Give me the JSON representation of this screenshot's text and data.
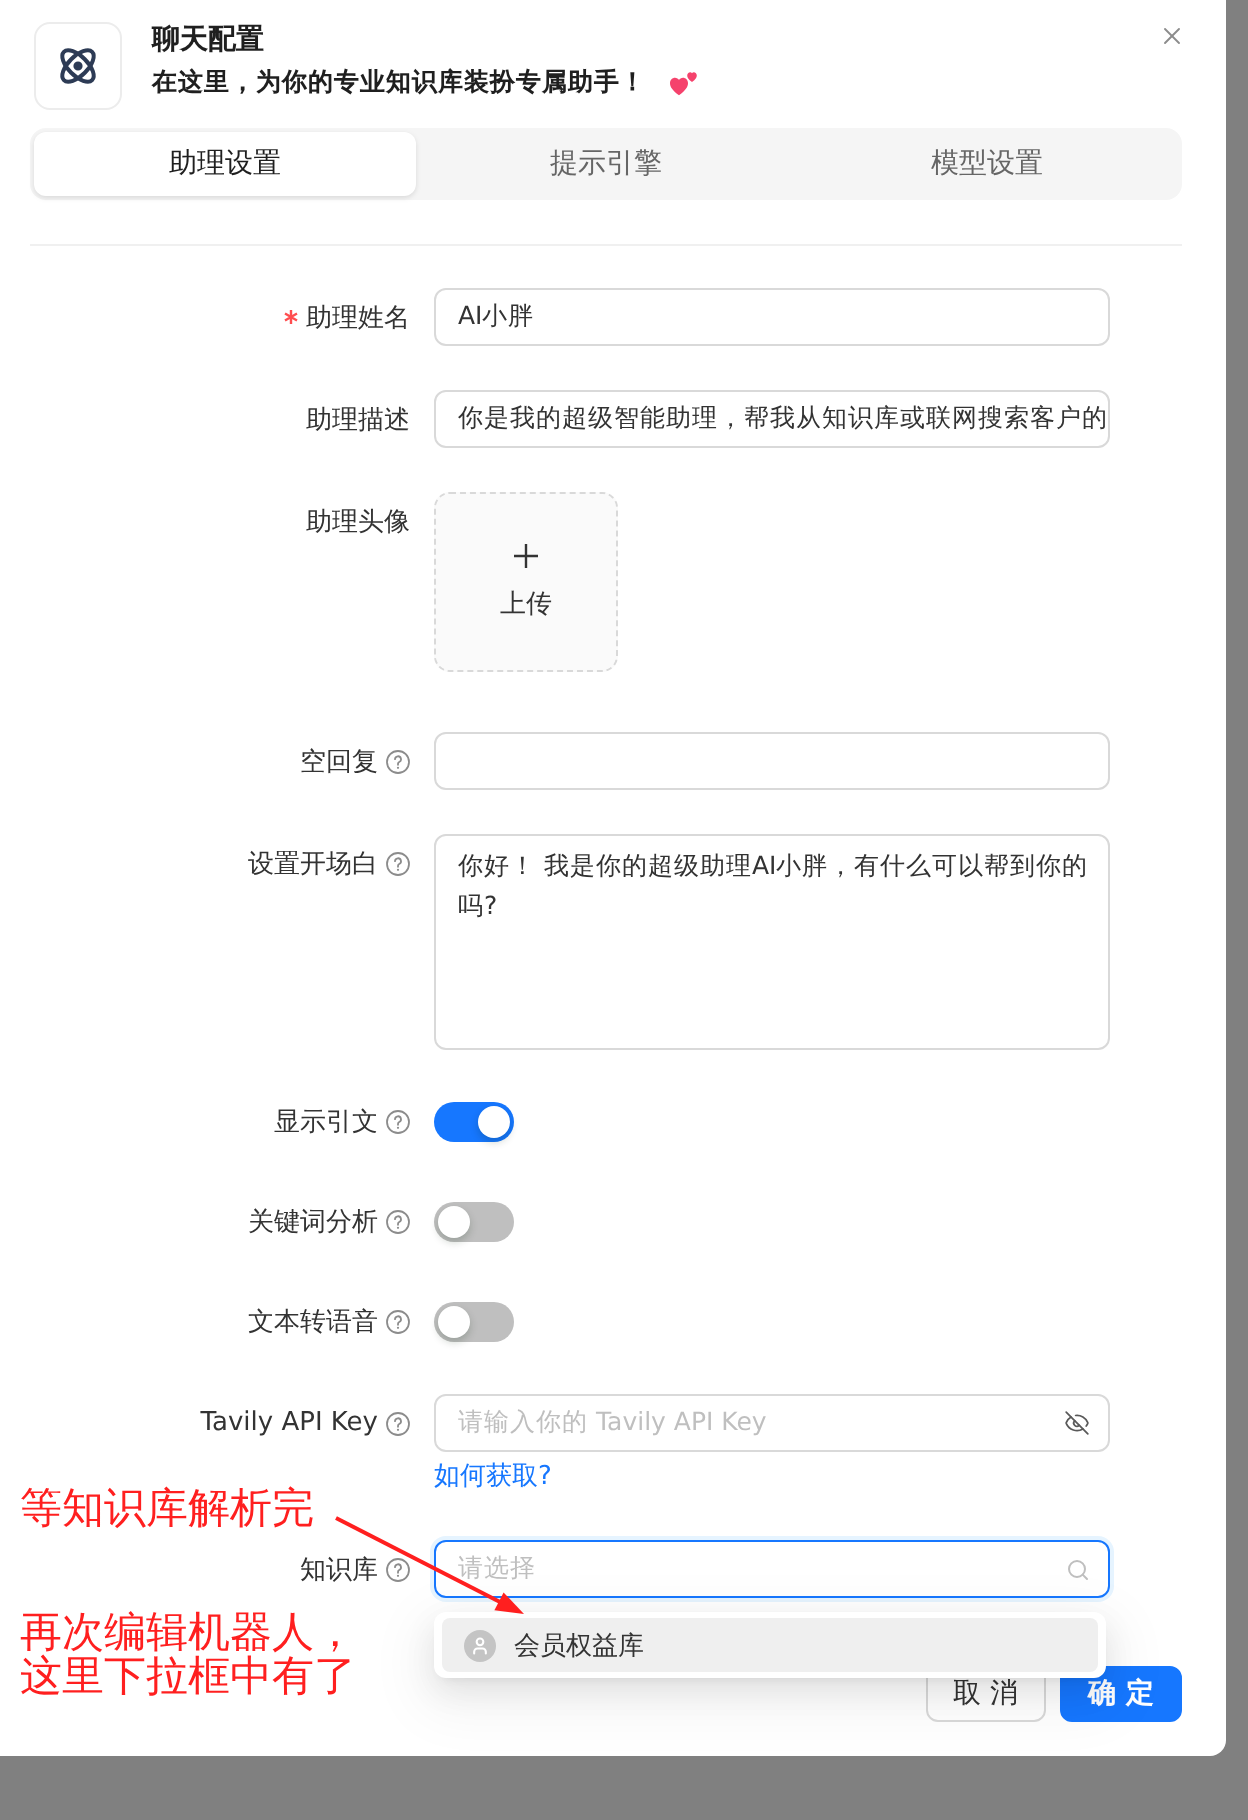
{
  "dialog": {
    "title": "聊天配置",
    "subtitle": "在这里，为你的专业知识库装扮专属助手！"
  },
  "tabs": [
    {
      "label": "助理设置",
      "selected": true
    },
    {
      "label": "提示引擎",
      "selected": false
    },
    {
      "label": "模型设置",
      "selected": false
    }
  ],
  "fields": [
    {
      "kind": "input",
      "label": "助理姓名",
      "required": true,
      "help": false,
      "value": "AI小胖"
    },
    {
      "kind": "input",
      "label": "助理描述",
      "required": false,
      "help": false,
      "value": "你是我的超级智能助理，帮我从知识库或联网搜索客户的"
    },
    {
      "kind": "upload",
      "label": "助理头像",
      "required": false,
      "help": false,
      "button": "上传"
    },
    {
      "kind": "input",
      "label": "空回复",
      "required": false,
      "help": true
    },
    {
      "kind": "textarea",
      "label": "设置开场白",
      "required": false,
      "help": true,
      "value": "你好！ 我是你的超级助理AI小胖，有什么可以帮到你的吗?"
    },
    {
      "kind": "switch",
      "label": "显示引文",
      "required": false,
      "help": true,
      "on": true
    },
    {
      "kind": "switch",
      "label": "关键词分析",
      "required": false,
      "help": true,
      "on": false
    },
    {
      "kind": "switch",
      "label": "文本转语音",
      "required": false,
      "help": true,
      "on": false
    },
    {
      "kind": "password",
      "label": "Tavily API Key",
      "required": false,
      "help": true,
      "placeholder": "请输入你的 Tavily API Key",
      "link": "如何获取?"
    },
    {
      "kind": "select",
      "label": "知识库",
      "required": false,
      "help": true,
      "placeholder": "请选择",
      "focused": true,
      "open": true,
      "options": [
        {
          "label": "会员权益库",
          "active": true,
          "selected": false
        }
      ]
    }
  ],
  "buttons": [
    {
      "kind": "default",
      "label": "取 消"
    },
    {
      "kind": "primary",
      "label": "确 定"
    }
  ],
  "annotations": [
    {
      "text": "等知识库解析完"
    },
    {
      "text": "再次编辑机器人，这里下拉框中有了"
    }
  ]
}
